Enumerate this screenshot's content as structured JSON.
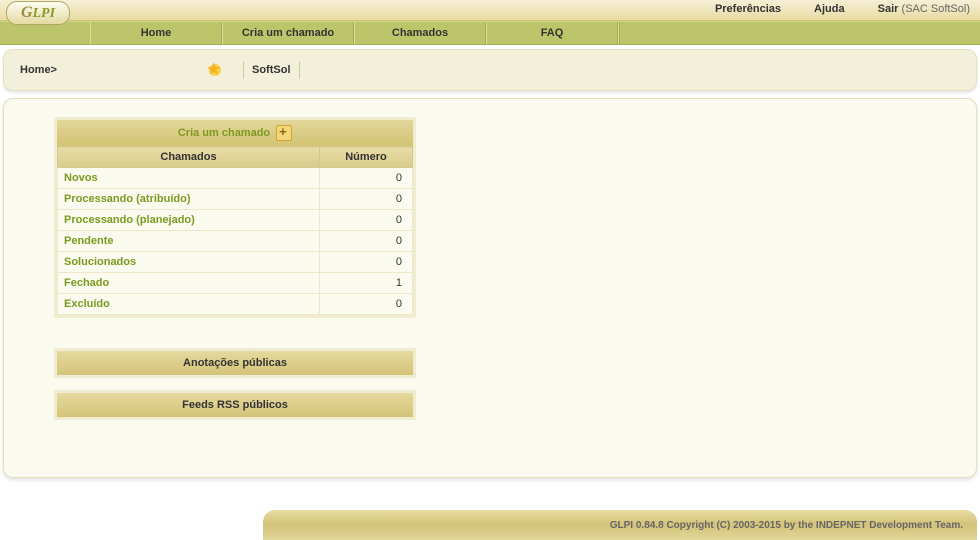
{
  "logo": "GLPI",
  "top_links": {
    "prefs": "Preferências",
    "help": "Ajuda",
    "logout": "Sair",
    "user": "(SAC SoftSol)"
  },
  "nav": [
    "Home",
    "Cria um chamado",
    "Chamados",
    "FAQ"
  ],
  "breadcrumb": {
    "home": "Home>",
    "entity": "SoftSol"
  },
  "ticket_panel": {
    "create_label": "Cria um chamado",
    "col_status": "Chamados",
    "col_number": "Número",
    "rows": [
      {
        "label": "Novos",
        "count": 0
      },
      {
        "label": "Processando (atribuído)",
        "count": 0
      },
      {
        "label": "Processando (planejado)",
        "count": 0
      },
      {
        "label": "Pendente",
        "count": 0
      },
      {
        "label": "Solucionados",
        "count": 0
      },
      {
        "label": "Fechado",
        "count": 1
      },
      {
        "label": "Excluído",
        "count": 0
      }
    ]
  },
  "notes_bar": "Anotações públicas",
  "rss_bar": "Feeds RSS públicos",
  "footer": "GLPI 0.84.8 Copyright (C) 2003-2015 by the INDEPNET Development Team."
}
